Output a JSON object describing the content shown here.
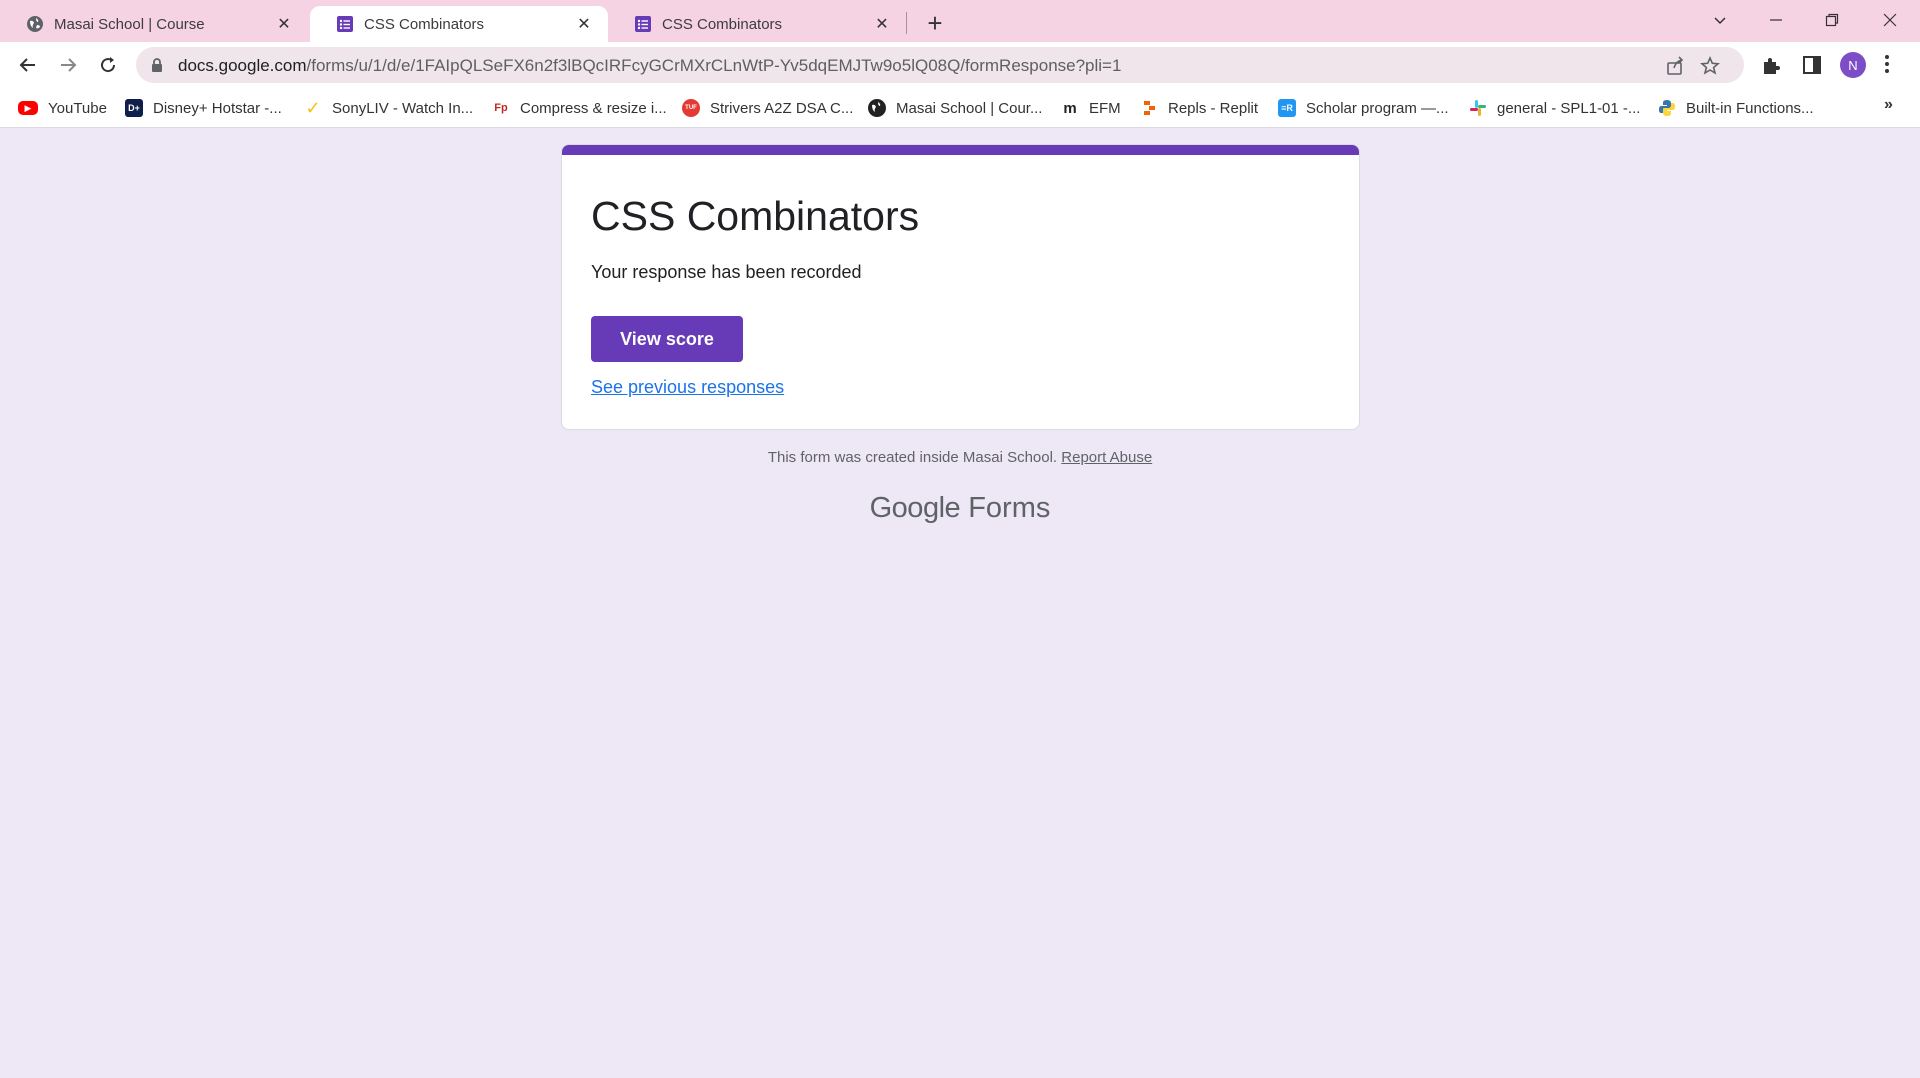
{
  "browser": {
    "tabs": [
      {
        "title": "Masai School | Course",
        "icon": "globe-icon",
        "active": false
      },
      {
        "title": "CSS Combinators",
        "icon": "google-forms-icon",
        "active": true
      },
      {
        "title": "CSS Combinators",
        "icon": "google-forms-icon",
        "active": false
      }
    ],
    "url_host": "docs.google.com",
    "url_path": "/forms/u/1/d/e/1FAIpQLSeFX6n2f3lBQcIRFcyGCrMXrCLnWtP-Yv5dqEMJTw9o5lQ08Q/formResponse?pli=1",
    "profile_initial": "N",
    "bookmarks": [
      {
        "label": "YouTube",
        "icon": "youtube-icon",
        "color": "#ff0000"
      },
      {
        "label": "Disney+ Hotstar -...",
        "icon": "hotstar-icon",
        "color": "#0f1e4a"
      },
      {
        "label": "SonyLIV - Watch In...",
        "icon": "sonyliv-icon",
        "color": "#f4c20d"
      },
      {
        "label": "Compress & resize i...",
        "icon": "compress-icon",
        "color": "#c62828"
      },
      {
        "label": "Strivers A2Z DSA C...",
        "icon": "takeuforward-icon",
        "color": "#e53935"
      },
      {
        "label": "Masai School | Cour...",
        "icon": "globe-icon",
        "color": "#333333"
      },
      {
        "label": "EFM",
        "icon": "efm-icon",
        "color": "#222222"
      },
      {
        "label": "Repls - Replit",
        "icon": "replit-icon",
        "color": "#f26207"
      },
      {
        "label": "Scholar program —...",
        "icon": "scholar-icon",
        "color": "#2196f3"
      },
      {
        "label": "general - SPL1-01 -...",
        "icon": "slack-icon",
        "color": "#4a154b"
      },
      {
        "label": "Built-in Functions...",
        "icon": "python-icon",
        "color": "#3776ab"
      }
    ]
  },
  "form": {
    "title": "CSS Combinators",
    "message": "Your response has been recorded",
    "view_score_label": "View score",
    "previous_responses_link": "See previous responses",
    "accent_color": "#673ab7"
  },
  "footer": {
    "note": "This form was created inside Masai School.",
    "report_abuse": "Report Abuse",
    "logo_google": "Google",
    "logo_forms": "Forms"
  }
}
